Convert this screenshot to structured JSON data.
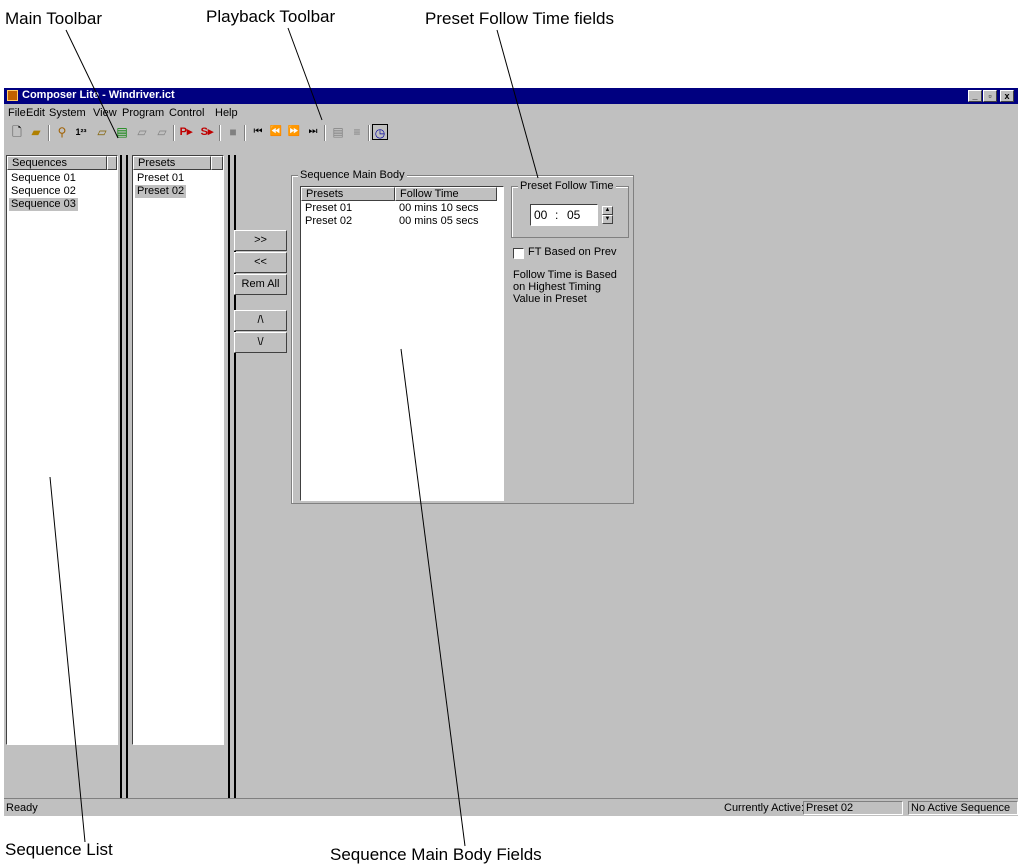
{
  "callouts": {
    "main_toolbar": "Main Toolbar",
    "playback_toolbar": "Playback Toolbar",
    "preset_follow_time_fields": "Preset Follow Time fields",
    "sequence_list": "Sequence List",
    "sequence_main_body_fields": "Sequence Main Body Fields"
  },
  "window": {
    "title": "Composer Lite - Windriver.ict",
    "controls": {
      "minimize": "_",
      "maximize": "▫",
      "close": "x"
    }
  },
  "menu": [
    "File",
    "Edit",
    "System",
    "View",
    "Program",
    "Control",
    "Help"
  ],
  "toolbar": {
    "main_icons": [
      "new-icon",
      "open-icon",
      "search-icon",
      "numbering-icon",
      "preset-icon",
      "preset-stack-icon",
      "preset-disabled-icon",
      "preset-disabled-2-icon"
    ],
    "play_preset_label": "P▸",
    "play_sequence_label": "S▸",
    "playback_icons": [
      "stop-icon",
      "skip-back-icon",
      "rewind-icon",
      "fast-forward-icon",
      "skip-forward-icon",
      "list-icon",
      "list-disabled-icon",
      "timer-icon"
    ],
    "numbering_label": "1²³"
  },
  "sequences": {
    "header": "Sequences",
    "items": [
      "Sequence 01",
      "Sequence 02",
      "Sequence 03"
    ],
    "selected_index": 2
  },
  "presets": {
    "header": "Presets",
    "items": [
      "Preset 01",
      "Preset 02"
    ],
    "selected_index": 1
  },
  "transfer_buttons": {
    "add": ">>",
    "remove": "<<",
    "remove_all": "Rem All",
    "move_up": "/\\",
    "move_down": "\\/"
  },
  "main_body": {
    "group_label": "Sequence Main Body",
    "columns": [
      "Presets",
      "Follow Time"
    ],
    "rows": [
      [
        "Preset 01",
        "00 mins 10 secs"
      ],
      [
        "Preset 02",
        "00 mins 05 secs"
      ]
    ]
  },
  "follow_time": {
    "group_label": "Preset Follow Time",
    "minutes": "00",
    "separator": ":",
    "seconds": "05",
    "checkbox_label": "FT Based on Prev",
    "checkbox_checked": false,
    "note": "Follow Time is Based on Highest Timing Value in Preset"
  },
  "status": {
    "left": "Ready",
    "active_label": "Currently Active:",
    "active_value": "Preset 02",
    "sequence_state": "No Active Sequence"
  }
}
